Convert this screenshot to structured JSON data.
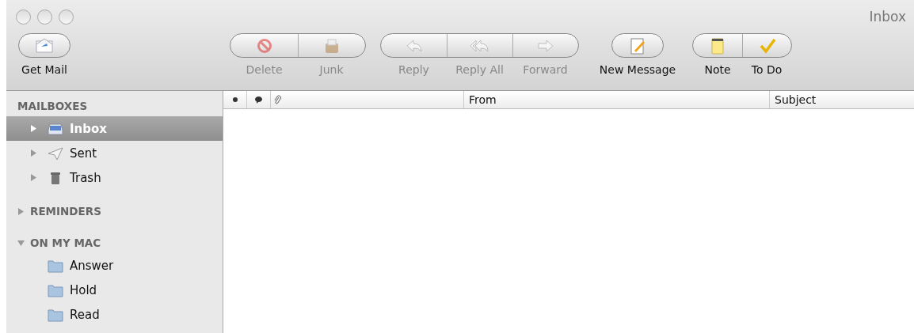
{
  "window": {
    "title": "Inbox"
  },
  "toolbar": {
    "groups": [
      {
        "buttons": [
          {
            "label": "Get Mail",
            "disabled": false
          }
        ]
      },
      {
        "buttons": [
          {
            "label": "Delete",
            "disabled": true
          },
          {
            "label": "Junk",
            "disabled": true
          }
        ]
      },
      {
        "buttons": [
          {
            "label": "Reply",
            "disabled": true
          },
          {
            "label": "Reply All",
            "disabled": true
          },
          {
            "label": "Forward",
            "disabled": true
          }
        ]
      },
      {
        "buttons": [
          {
            "label": "New Message",
            "disabled": false
          }
        ]
      },
      {
        "buttons": [
          {
            "label": "Note",
            "disabled": false
          },
          {
            "label": "To Do",
            "disabled": false
          }
        ]
      }
    ]
  },
  "sidebar": {
    "sections": [
      {
        "title": "MAILBOXES",
        "kind": "header",
        "items": [
          {
            "label": "Inbox",
            "kind": "inbox",
            "selected": true,
            "expanded": false
          },
          {
            "label": "Sent",
            "kind": "sent",
            "selected": false,
            "expanded": false
          },
          {
            "label": "Trash",
            "kind": "trash",
            "selected": false,
            "expanded": false
          }
        ]
      },
      {
        "title": "REMINDERS",
        "kind": "disclosure",
        "expanded": false
      },
      {
        "title": "ON MY MAC",
        "kind": "disclosure",
        "expanded": true,
        "items": [
          {
            "label": "Answer",
            "kind": "folder",
            "selected": false
          },
          {
            "label": "Hold",
            "kind": "folder",
            "selected": false
          },
          {
            "label": "Read",
            "kind": "folder",
            "selected": false
          }
        ]
      }
    ]
  },
  "message_list": {
    "columns": [
      "From",
      "Subject"
    ]
  }
}
